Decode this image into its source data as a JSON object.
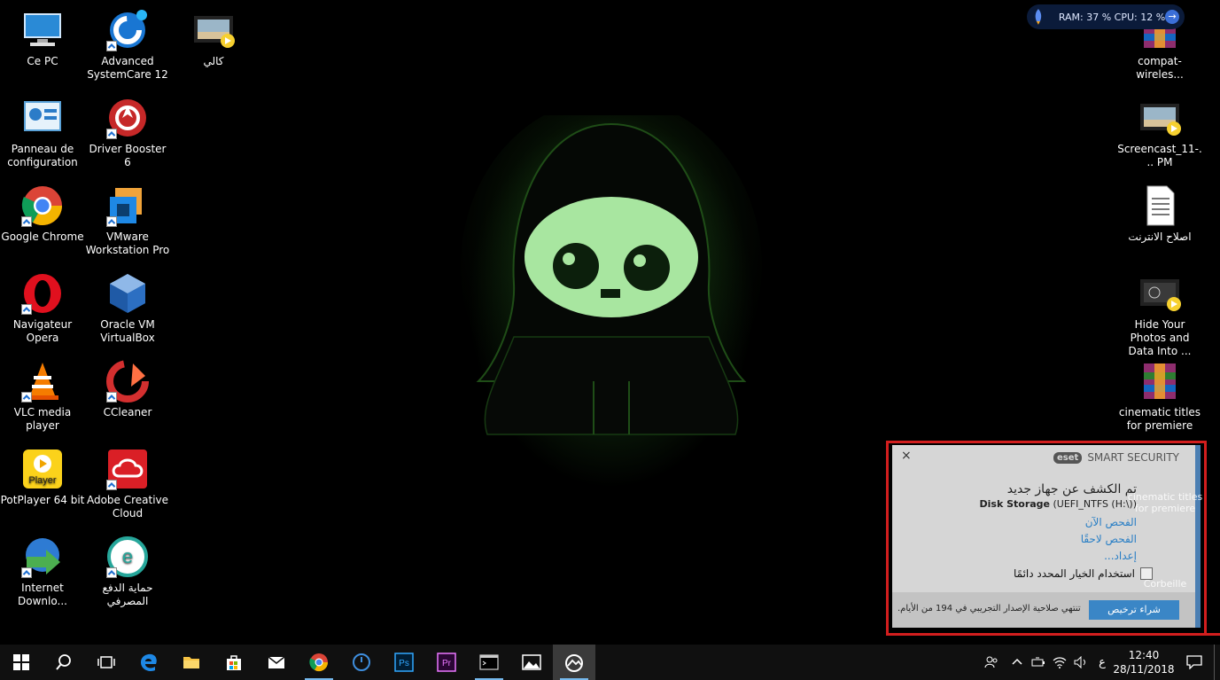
{
  "desktop": {
    "icons_left": [
      {
        "label": "Ce PC",
        "icon": "computer-icon"
      },
      {
        "label": "Advanced SystemCare 12",
        "icon": "advanced-systemcare-icon"
      },
      {
        "label": "كالي",
        "icon": "video-file-icon"
      },
      {
        "label": "Panneau de configuration",
        "icon": "control-panel-icon"
      },
      {
        "label": "Driver Booster 6",
        "icon": "driver-booster-icon"
      },
      {
        "label": "Google Chrome",
        "icon": "chrome-icon"
      },
      {
        "label": "VMware Workstation Pro",
        "icon": "vmware-icon"
      },
      {
        "label": "Navigateur Opera",
        "icon": "opera-icon"
      },
      {
        "label": "Oracle VM VirtualBox",
        "icon": "virtualbox-icon"
      },
      {
        "label": "VLC media player",
        "icon": "vlc-icon"
      },
      {
        "label": "CCleaner",
        "icon": "ccleaner-icon"
      },
      {
        "label": "PotPlayer 64 bit",
        "icon": "potplayer-icon"
      },
      {
        "label": "Adobe Creative Cloud",
        "icon": "creative-cloud-icon"
      },
      {
        "label": "Internet Downlo...",
        "icon": "idm-icon"
      },
      {
        "label": "حماية الدفع المصرفي",
        "icon": "eset-banking-icon"
      }
    ],
    "icons_right": [
      {
        "label": "compat-wireles...",
        "icon": "winrar-icon"
      },
      {
        "label": "Screencast_11-... PM",
        "icon": "video-file-icon"
      },
      {
        "label": "اصلاح الانترنت",
        "icon": "text-file-icon"
      },
      {
        "label": "Hide Your Photos and Data Into ...",
        "icon": "video-file-icon"
      },
      {
        "label": "cinematic titles for premiere",
        "icon": "winrar-icon"
      }
    ],
    "potplayer_badge": "Player"
  },
  "system_monitor": {
    "text": "RAM: 37 %  CPU: 12 %",
    "arrow": "→"
  },
  "eset_popup": {
    "brand_logo": "eset",
    "brand_name": "SMART SECURITY",
    "close": "×",
    "title": "تم الكشف عن جهاز جديد",
    "device_name": "Disk Storage",
    "device_detail": " (UEFI_NTFS (H:\\))",
    "action_scan_now": "الفحص الآن",
    "action_scan_later": "الفحص لاحقًا",
    "action_setup": "إعداد...",
    "checkbox_label": "استخدام الخيار المحدد دائمًا",
    "buy_button": "شراء ترخيص",
    "trial_notice": "تنتهي صلاحية الإصدار التجريبي في 194 من الأيام.",
    "ghost_label_1": "cinematic titles for premiere",
    "ghost_label_2": "Corbeille"
  },
  "taskbar": {
    "apps": [
      "start-icon",
      "search-icon",
      "task-view-icon",
      "edge-icon",
      "file-explorer-icon",
      "store-icon",
      "mail-icon",
      "chrome-icon",
      "power-icon",
      "photoshop-icon",
      "premiere-icon",
      "terminal-icon",
      "photos-icon",
      "camera-app-icon"
    ],
    "photoshop_label": "Ps",
    "premiere_label": "Pr",
    "tray_lang": "ع",
    "clock_time": "12:40",
    "clock_date": "28/11/2018"
  }
}
